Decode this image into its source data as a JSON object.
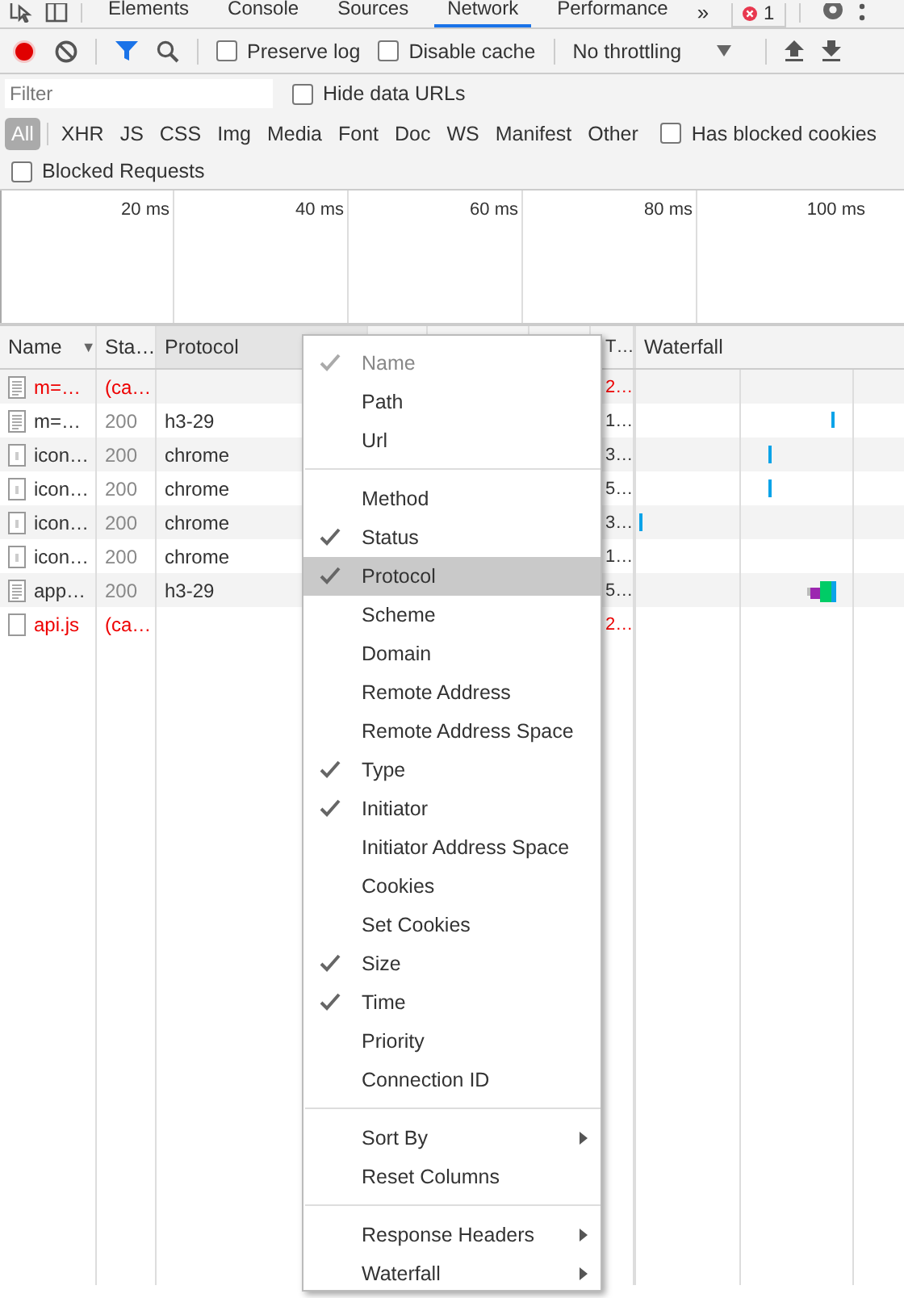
{
  "tabs": [
    {
      "label": "Elements",
      "selected": false
    },
    {
      "label": "Console",
      "selected": false
    },
    {
      "label": "Sources",
      "selected": false
    },
    {
      "label": "Network",
      "selected": true
    },
    {
      "label": "Performance",
      "selected": false
    }
  ],
  "more_tabs": "»",
  "error_badge": {
    "count": "1"
  },
  "toolbar": {
    "recording": true,
    "filter_active": true,
    "checkboxes": [
      {
        "label": "Preserve log",
        "checked": false
      },
      {
        "label": "Disable cache",
        "checked": false
      }
    ],
    "throttling": "No throttling"
  },
  "filter": {
    "placeholder": "Filter",
    "hide_data_urls": {
      "label": "Hide data URLs",
      "checked": false
    }
  },
  "type_filters": [
    {
      "label": "All",
      "selected": true
    },
    {
      "label": "XHR",
      "selected": false
    },
    {
      "label": "JS",
      "selected": false
    },
    {
      "label": "CSS",
      "selected": false
    },
    {
      "label": "Img",
      "selected": false
    },
    {
      "label": "Media",
      "selected": false
    },
    {
      "label": "Font",
      "selected": false
    },
    {
      "label": "Doc",
      "selected": false
    },
    {
      "label": "WS",
      "selected": false
    },
    {
      "label": "Manifest",
      "selected": false
    },
    {
      "label": "Other",
      "selected": false
    }
  ],
  "has_blocked_cookies": {
    "label": "Has blocked cookies",
    "checked": false
  },
  "blocked_requests": {
    "label": "Blocked Requests",
    "checked": false
  },
  "overview_ticks": [
    "20 ms",
    "40 ms",
    "60 ms",
    "80 ms",
    "100 ms"
  ],
  "table": {
    "columns": [
      "Name",
      "Sta…",
      "Protocol",
      "T…",
      "Waterfall"
    ],
    "sort_icon": "▼",
    "rows": [
      {
        "kind": "doc",
        "name": "m=…",
        "status": "(ca…",
        "protocol": "",
        "column_4": "2…",
        "failed": true
      },
      {
        "kind": "doc",
        "name": "m=…",
        "status": "200",
        "protocol": "h3-29",
        "column_4": "1…",
        "failed": false
      },
      {
        "kind": "img",
        "name": "icon…",
        "status": "200",
        "protocol": "chrome",
        "column_4": "3…",
        "failed": false
      },
      {
        "kind": "img",
        "name": "icon…",
        "status": "200",
        "protocol": "chrome",
        "column_4": "5…",
        "failed": false
      },
      {
        "kind": "img",
        "name": "icon…",
        "status": "200",
        "protocol": "chrome",
        "column_4": "3…",
        "failed": false
      },
      {
        "kind": "img",
        "name": "icon…",
        "status": "200",
        "protocol": "chrome",
        "column_4": "1…",
        "failed": false
      },
      {
        "kind": "doc",
        "name": "app…",
        "status": "200",
        "protocol": "h3-29",
        "column_4": "5…",
        "failed": false
      },
      {
        "kind": "blank",
        "name": "api.js",
        "status": "(ca…",
        "protocol": "",
        "column_4": "2…",
        "failed": true
      }
    ]
  },
  "context_menu": [
    {
      "kind": "item",
      "label": "Name",
      "checked": true,
      "disabled": true,
      "selected": false
    },
    {
      "kind": "item",
      "label": "Path",
      "checked": false,
      "disabled": false,
      "selected": false
    },
    {
      "kind": "item",
      "label": "Url",
      "checked": false,
      "disabled": false,
      "selected": false
    },
    {
      "kind": "separator"
    },
    {
      "kind": "item",
      "label": "Method",
      "checked": false,
      "disabled": false,
      "selected": false
    },
    {
      "kind": "item",
      "label": "Status",
      "checked": true,
      "disabled": false,
      "selected": false
    },
    {
      "kind": "item",
      "label": "Protocol",
      "checked": true,
      "disabled": false,
      "selected": true
    },
    {
      "kind": "item",
      "label": "Scheme",
      "checked": false,
      "disabled": false,
      "selected": false
    },
    {
      "kind": "item",
      "label": "Domain",
      "checked": false,
      "disabled": false,
      "selected": false
    },
    {
      "kind": "item",
      "label": "Remote Address",
      "checked": false,
      "disabled": false,
      "selected": false
    },
    {
      "kind": "item",
      "label": "Remote Address Space",
      "checked": false,
      "disabled": false,
      "selected": false
    },
    {
      "kind": "item",
      "label": "Type",
      "checked": true,
      "disabled": false,
      "selected": false
    },
    {
      "kind": "item",
      "label": "Initiator",
      "checked": true,
      "disabled": false,
      "selected": false
    },
    {
      "kind": "item",
      "label": "Initiator Address Space",
      "checked": false,
      "disabled": false,
      "selected": false
    },
    {
      "kind": "item",
      "label": "Cookies",
      "checked": false,
      "disabled": false,
      "selected": false
    },
    {
      "kind": "item",
      "label": "Set Cookies",
      "checked": false,
      "disabled": false,
      "selected": false
    },
    {
      "kind": "item",
      "label": "Size",
      "checked": true,
      "disabled": false,
      "selected": false
    },
    {
      "kind": "item",
      "label": "Time",
      "checked": true,
      "disabled": false,
      "selected": false
    },
    {
      "kind": "item",
      "label": "Priority",
      "checked": false,
      "disabled": false,
      "selected": false
    },
    {
      "kind": "item",
      "label": "Connection ID",
      "checked": false,
      "disabled": false,
      "selected": false
    },
    {
      "kind": "separator"
    },
    {
      "kind": "submenu",
      "label": "Sort By",
      "checked": false,
      "disabled": false,
      "selected": false
    },
    {
      "kind": "item",
      "label": "Reset Columns",
      "checked": false,
      "disabled": false,
      "selected": false
    },
    {
      "kind": "separator"
    },
    {
      "kind": "submenu",
      "label": "Response Headers",
      "checked": false,
      "disabled": false,
      "selected": false
    },
    {
      "kind": "submenu",
      "label": "Waterfall",
      "checked": false,
      "disabled": false,
      "selected": false
    }
  ]
}
